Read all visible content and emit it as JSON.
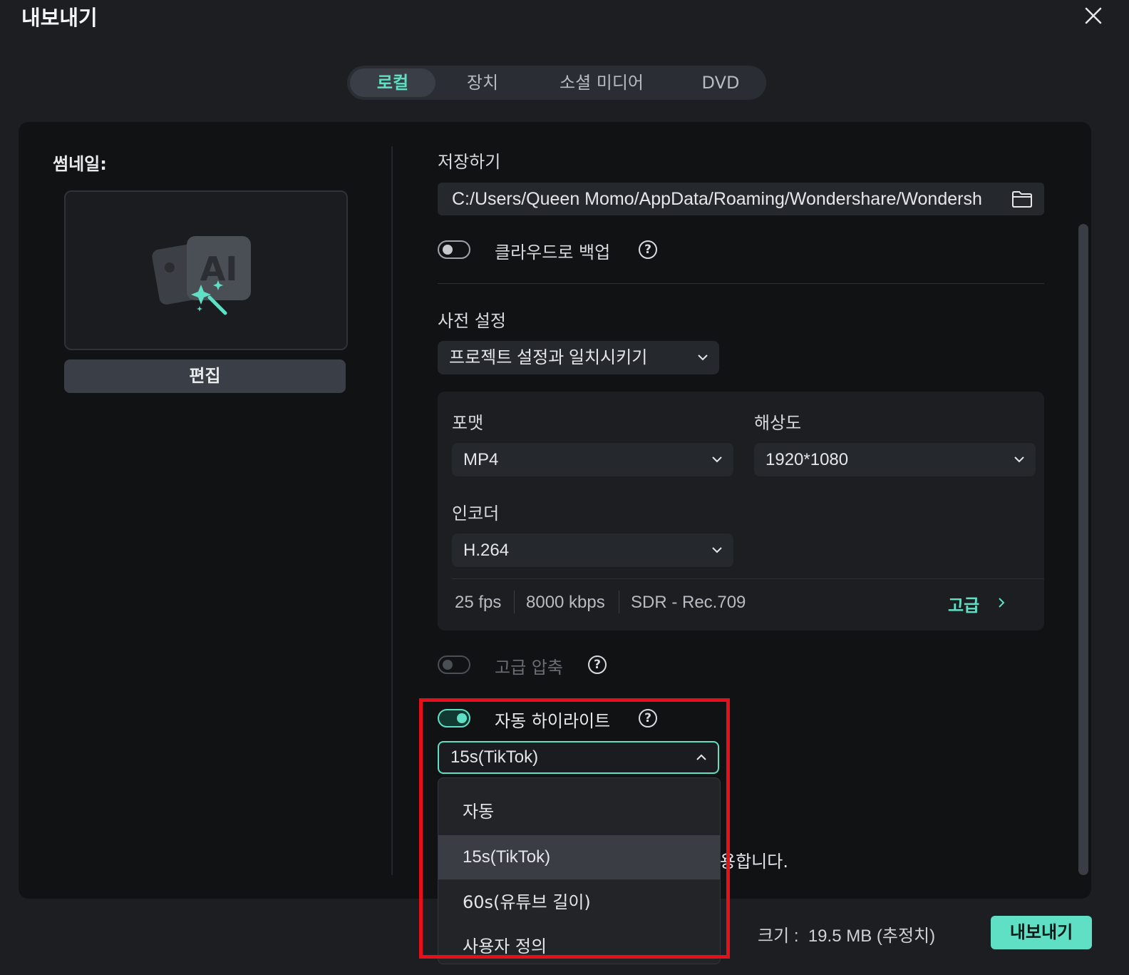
{
  "window": {
    "title": "내보내기"
  },
  "tabs": [
    {
      "label": "로컬",
      "active": true
    },
    {
      "label": "장치",
      "active": false
    },
    {
      "label": "소셜 미디어",
      "active": false
    },
    {
      "label": "DVD",
      "active": false
    }
  ],
  "thumbnail": {
    "label": "썸네일:",
    "edit_label": "편집",
    "image_text": "AI"
  },
  "save": {
    "label": "저장하기",
    "path": "C:/Users/Queen Momo/AppData/Roaming/Wondershare/Wondersh"
  },
  "cloud_backup": {
    "label": "클라우드로 백업",
    "enabled": false
  },
  "preset": {
    "label": "사전 설정",
    "value": "프로젝트 설정과 일치시키기"
  },
  "format": {
    "label": "포맷",
    "value": "MP4"
  },
  "resolution": {
    "label": "해상도",
    "value": "1920*1080"
  },
  "encoder": {
    "label": "인코더",
    "value": "H.264"
  },
  "meta": {
    "fps": "25 fps",
    "bitrate": "8000 kbps",
    "color": "SDR - Rec.709",
    "advanced_label": "고급"
  },
  "advanced_compression": {
    "label": "고급 압축",
    "enabled": false,
    "disabled": true
  },
  "auto_highlight": {
    "label": "자동 하이라이트",
    "enabled": true,
    "selected": "15s(TikTok)",
    "options": [
      "자동",
      "15s(TikTok)",
      "60s(유튜브 길이)",
      "사용자 정의"
    ]
  },
  "partial_text": "용합니다.",
  "footer": {
    "size_text": "크기 :  19.5 MB (추정치)",
    "export_label": "내보내기"
  },
  "colors": {
    "accent": "#5fe0c4",
    "highlight_box": "#e5101a",
    "background": "#1c1e22"
  }
}
